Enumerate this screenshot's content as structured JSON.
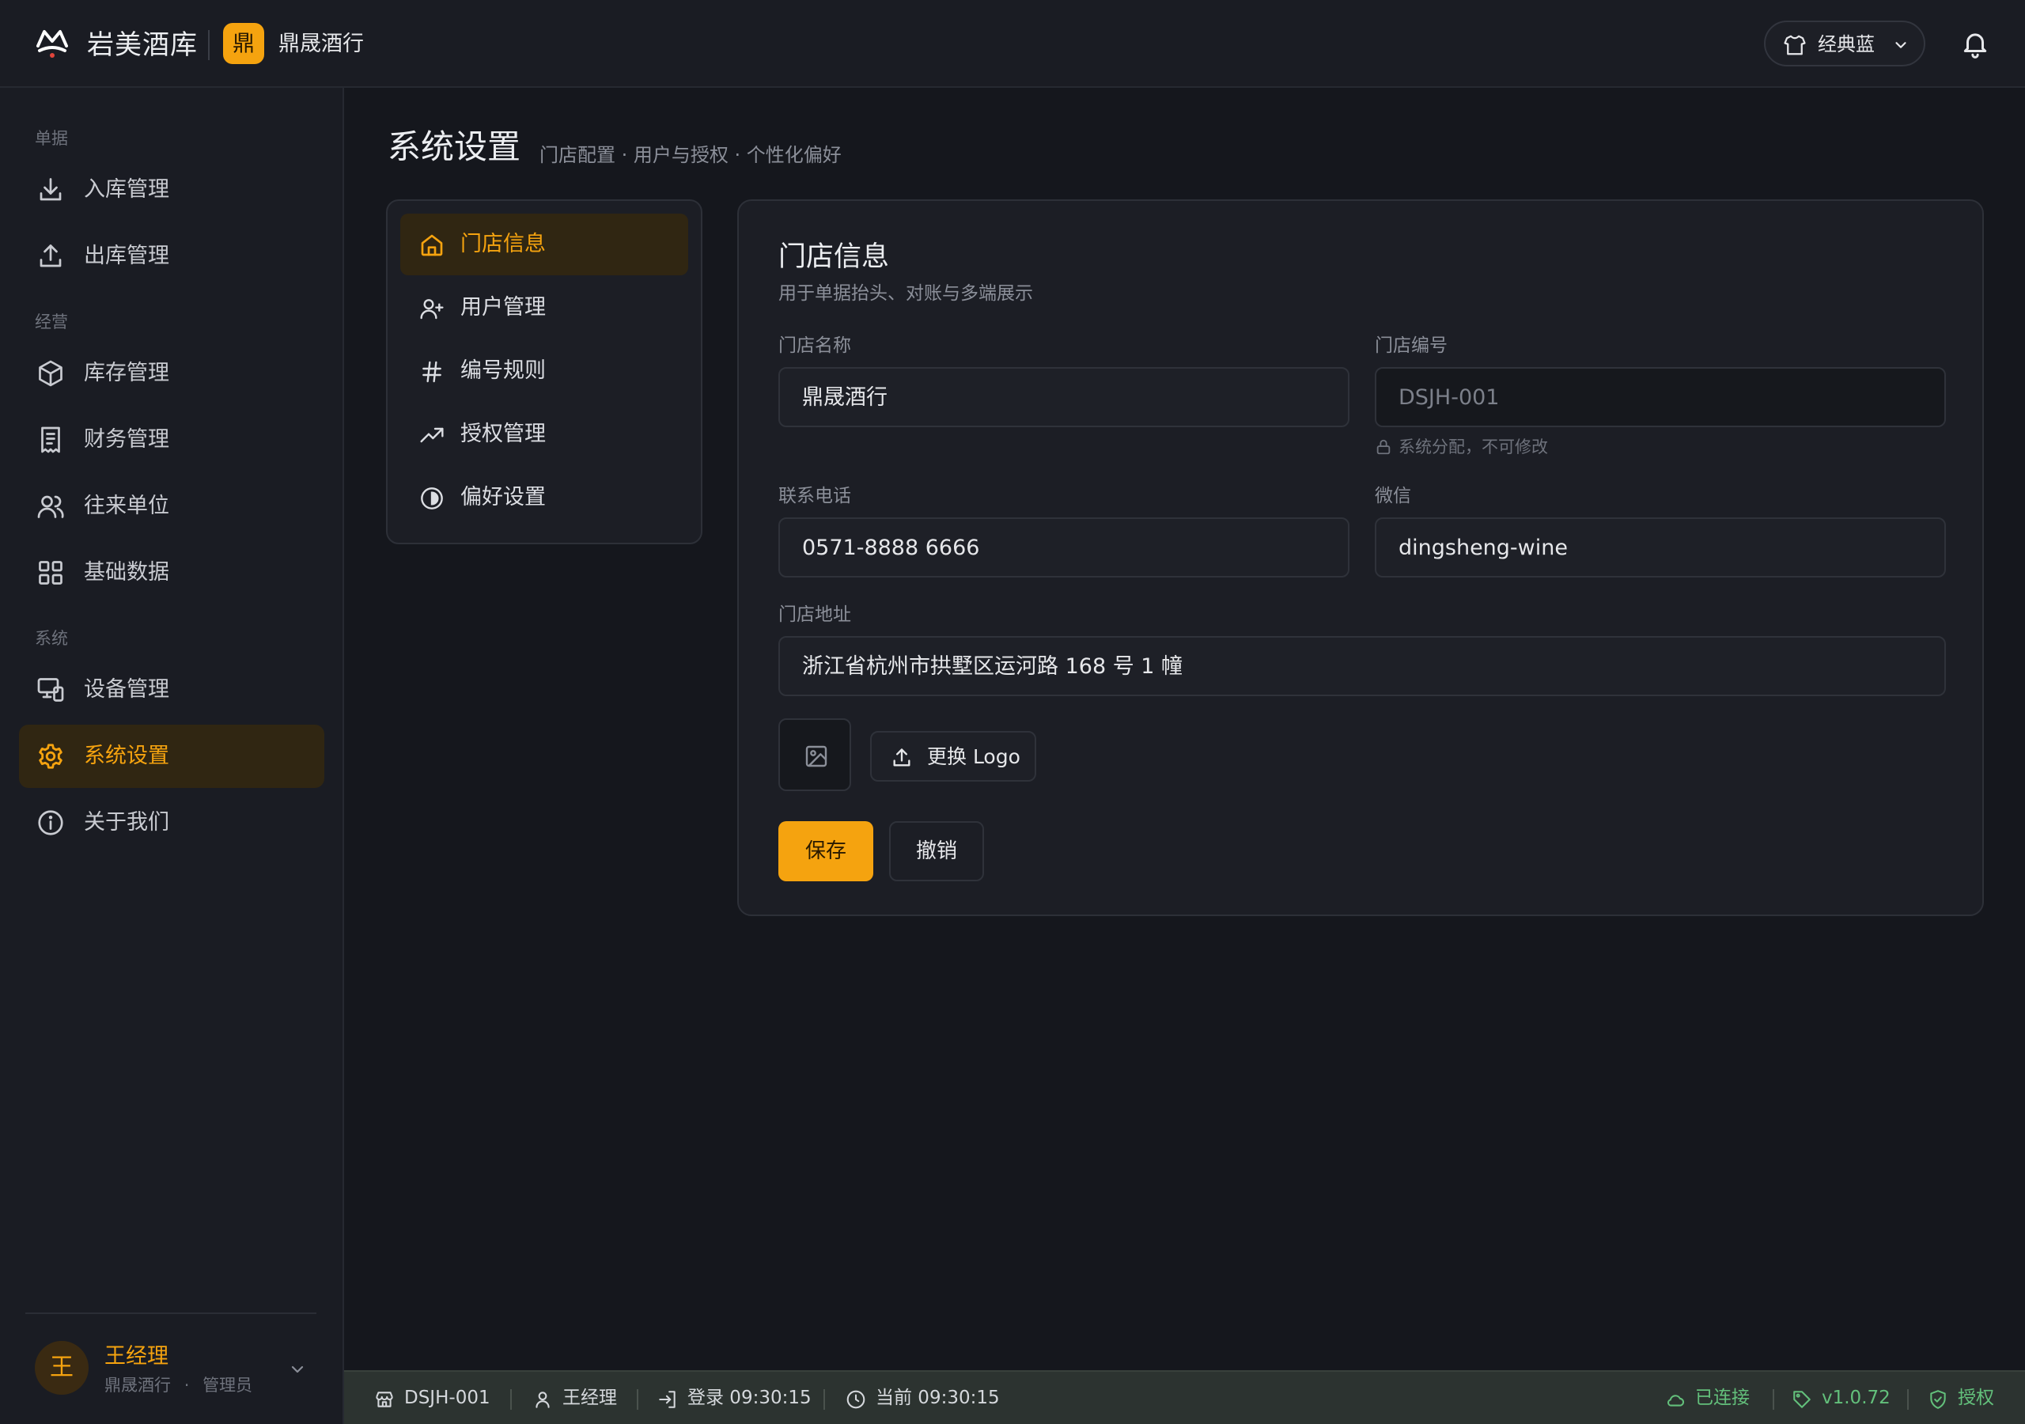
{
  "app": {
    "name": "岩美酒库"
  },
  "store": {
    "badge": "鼎",
    "name": "鼎晟酒行"
  },
  "topbar": {
    "theme_label": "经典蓝",
    "theme_icon": "shirt-icon",
    "notification_icon": "bell-icon"
  },
  "sidebar": {
    "sections": [
      {
        "label": "单据",
        "items": [
          {
            "label": "入库管理",
            "icon": "download-icon"
          },
          {
            "label": "出库管理",
            "icon": "upload-icon"
          }
        ]
      },
      {
        "label": "经营",
        "items": [
          {
            "label": "库存管理",
            "icon": "box-icon"
          },
          {
            "label": "财务管理",
            "icon": "receipt-icon"
          },
          {
            "label": "往来单位",
            "icon": "users-icon"
          },
          {
            "label": "基础数据",
            "icon": "grid-icon"
          }
        ]
      },
      {
        "label": "系统",
        "items": [
          {
            "label": "设备管理",
            "icon": "devices-icon"
          },
          {
            "label": "系统设置",
            "icon": "gear-icon",
            "active": true
          },
          {
            "label": "关于我们",
            "icon": "info-icon"
          }
        ]
      }
    ],
    "user": {
      "avatar": "王",
      "name": "王经理",
      "store": "鼎晟酒行",
      "separator": "·",
      "role": "管理员"
    }
  },
  "page": {
    "title": "系统设置",
    "subtitle": "门店配置 · 用户与授权 · 个性化偏好"
  },
  "settings_menu": [
    {
      "label": "门店信息",
      "icon": "home-icon",
      "active": true
    },
    {
      "label": "用户管理",
      "icon": "user-plus-icon"
    },
    {
      "label": "编号规则",
      "icon": "hash-icon"
    },
    {
      "label": "授权管理",
      "icon": "trending-up-icon"
    },
    {
      "label": "偏好设置",
      "icon": "theme-circle-icon"
    }
  ],
  "store_info": {
    "title": "门店信息",
    "description": "用于单据抬头、对账与多端展示",
    "fields": {
      "name": {
        "label": "门店名称",
        "value": "鼎晟酒行"
      },
      "code": {
        "label": "门店编号",
        "value": "DSJH-001",
        "hint": "系统分配，不可修改"
      },
      "phone": {
        "label": "联系电话",
        "value": "0571-8888 6666"
      },
      "wechat": {
        "label": "微信",
        "value": "dingsheng-wine"
      },
      "address": {
        "label": "门店地址",
        "value": "浙江省杭州市拱墅区运河路 168 号 1 幢"
      }
    },
    "change_logo_label": "更换 Logo",
    "save_label": "保存",
    "cancel_label": "撤销"
  },
  "statusbar": {
    "store_code": "DSJH-001",
    "user": "王经理",
    "login": "登录 09:30:15",
    "now": "当前 09:30:15",
    "connection": "已连接",
    "version": "v1.0.72",
    "license": "授权"
  },
  "colors": {
    "accent": "#f5a30f",
    "background": "#15171d",
    "panel": "#1c1e25",
    "success": "#63c07b"
  }
}
